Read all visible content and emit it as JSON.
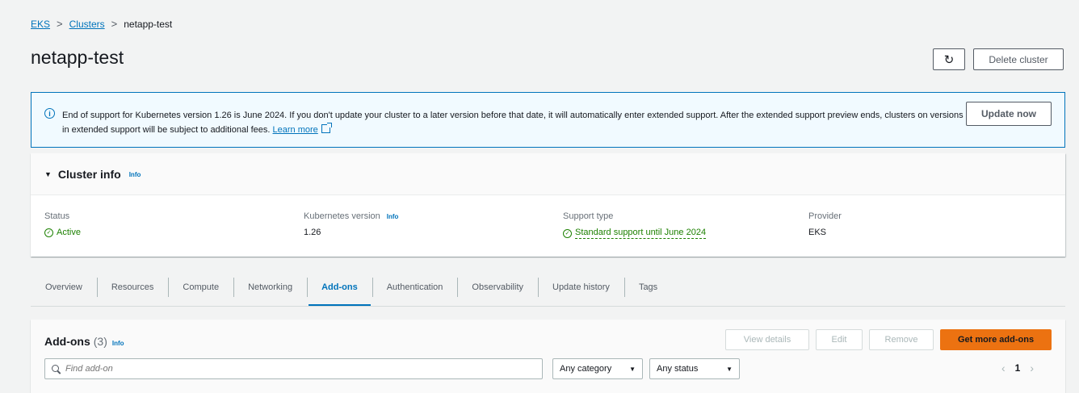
{
  "breadcrumb": {
    "items": [
      {
        "label": "EKS"
      },
      {
        "label": "Clusters"
      }
    ],
    "current": "netapp-test",
    "separator": ">"
  },
  "page": {
    "title": "netapp-test",
    "refresh_icon": "↻",
    "delete_label": "Delete cluster"
  },
  "banner": {
    "icon": "i",
    "text": "End of support for Kubernetes version 1.26 is June 2024. If you don't update your cluster to a later version before that date, it will automatically enter extended support. After the extended support preview ends, clusters on versions in extended support will be subject to additional fees.",
    "link": "Learn more",
    "button": "Update now"
  },
  "cluster_info": {
    "title": "Cluster info",
    "info": "Info",
    "status_label": "Status",
    "status_value": "Active",
    "k8s_label": "Kubernetes version",
    "k8s_info": "Info",
    "k8s_value": "1.26",
    "support_label": "Support type",
    "support_value": "Standard support until June 2024",
    "provider_label": "Provider",
    "provider_value": "EKS"
  },
  "tabs": [
    {
      "label": "Overview"
    },
    {
      "label": "Resources"
    },
    {
      "label": "Compute"
    },
    {
      "label": "Networking"
    },
    {
      "label": "Add-ons"
    },
    {
      "label": "Authentication"
    },
    {
      "label": "Observability"
    },
    {
      "label": "Update history"
    },
    {
      "label": "Tags"
    }
  ],
  "addons": {
    "title": "Add-ons",
    "count": "(3)",
    "info": "Info",
    "view_details": "View details",
    "edit": "Edit",
    "remove": "Remove",
    "get_more": "Get more add-ons",
    "search_placeholder": "Find add-on",
    "category": "Any category",
    "status": "Any status",
    "page": "1",
    "prev": "‹",
    "next": "›",
    "dropdown_icon": "▼"
  },
  "colors": {
    "link": "#0073bb",
    "success": "#1d8102",
    "primary_button": "#ec7211",
    "banner_bg": "#f1faff"
  }
}
